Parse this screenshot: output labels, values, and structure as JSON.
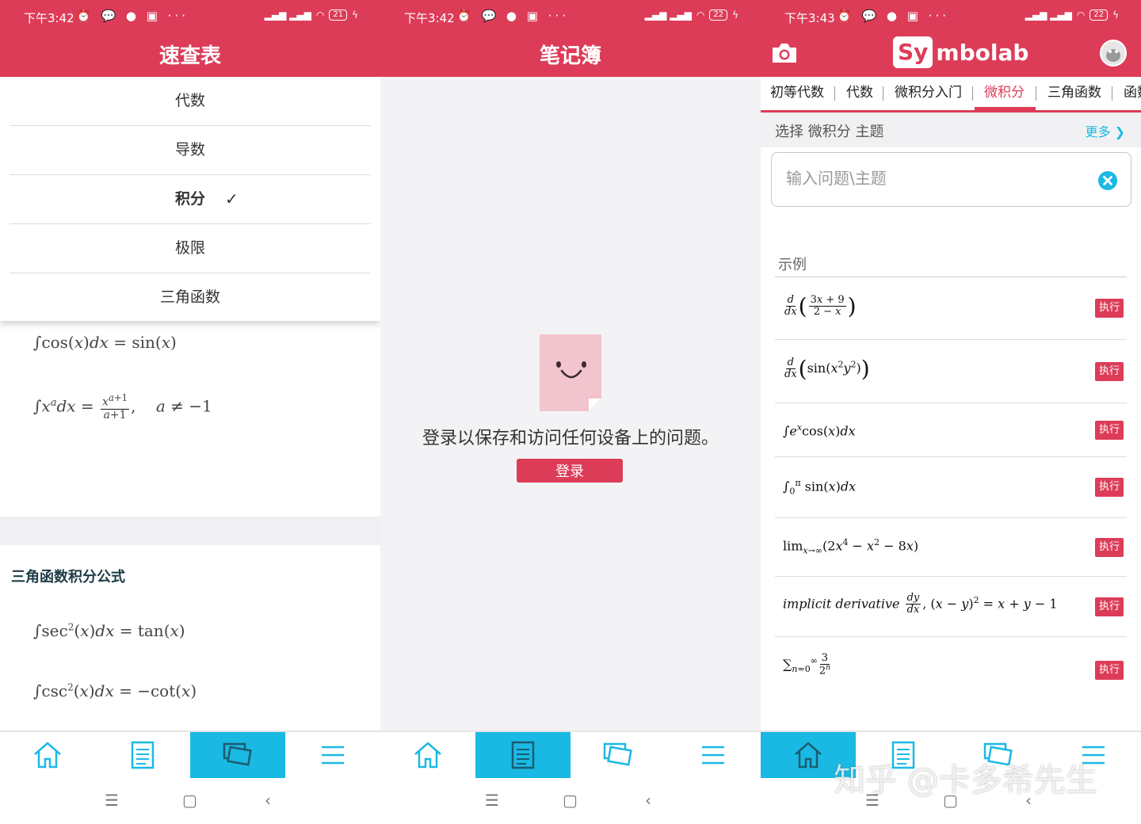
{
  "colors": {
    "brand": "#dd3c58",
    "accent": "#1ab9e4"
  },
  "panels": [
    {
      "status": {
        "time": "下午3:42",
        "battery": "21"
      },
      "title": "速查表",
      "menu": [
        "代数",
        "导数",
        "积分",
        "极限",
        "三角函数"
      ],
      "menu_selected_index": 2,
      "section_title": "三角函数积分公式",
      "nav_active": "cheat-sheet"
    },
    {
      "status": {
        "time": "下午3:42",
        "battery": "22"
      },
      "title": "笔记簿",
      "message": "登录以保存和访问任何设备上的问题。",
      "login_label": "登录",
      "nav_active": "notebook"
    },
    {
      "status": {
        "time": "下午3:43",
        "battery": "22"
      },
      "logo_sy": "Sy",
      "logo_rest": "mbolab",
      "tabs": [
        "初等代数",
        "代数",
        "微积分入门",
        "微积分",
        "三角函数",
        "函数"
      ],
      "active_tab_index": 3,
      "topic_label": "选择 微积分 主题",
      "more_label": "更多",
      "search_placeholder": "输入问题\\主题",
      "examples_label": "示例",
      "run_label": "执行",
      "implicit_text": "implicit derivative",
      "nav_active": "home"
    }
  ],
  "watermark": "知乎 @卡多希先生"
}
